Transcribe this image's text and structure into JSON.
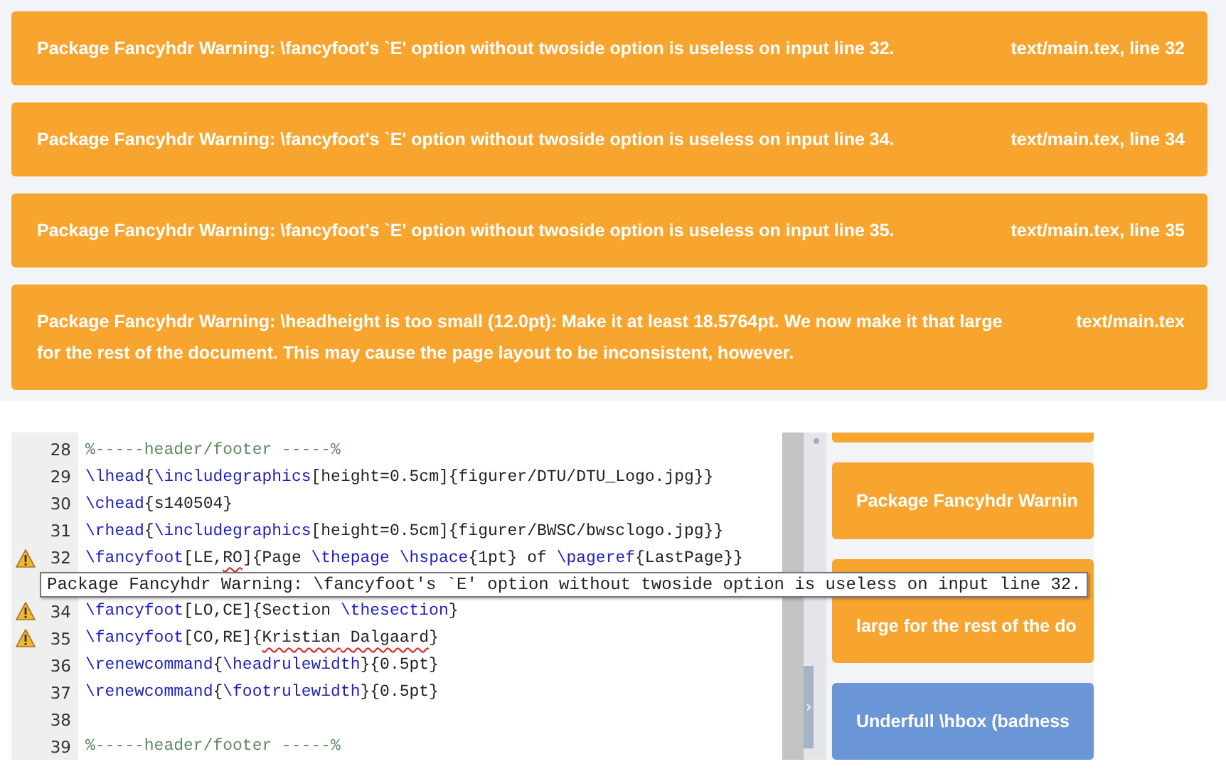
{
  "messages": [
    {
      "color": "#f8a52f",
      "text": "Package Fancyhdr Warning: \\fancyfoot's `E' option without twoside option is useless on input line 32.",
      "location": "text/main.tex, line 32"
    },
    {
      "color": "#f8a52f",
      "text": "Package Fancyhdr Warning: \\fancyfoot's `E' option without twoside option is useless on input line 34.",
      "location": "text/main.tex, line 34"
    },
    {
      "color": "#f8a52f",
      "text": "Package Fancyhdr Warning: \\fancyfoot's `E' option without twoside option is useless on input line 35.",
      "location": "text/main.tex, line 35"
    },
    {
      "color": "#f8a52f",
      "text": "Package Fancyhdr Warning: \\headheight is too small (12.0pt): Make it at least 18.5764pt. We now make it that large for the rest of the document. This may cause the page layout to be inconsistent, however.",
      "location": "text/main.tex"
    }
  ],
  "editor": {
    "lines": [
      {
        "kind": "code",
        "number": "28",
        "warning": false,
        "tokens": [
          {
            "kind": "comment",
            "text": "%-----header/footer -----%"
          }
        ]
      },
      {
        "kind": "code",
        "number": "29",
        "warning": false,
        "tokens": [
          {
            "kind": "command",
            "text": "\\lhead"
          },
          {
            "kind": "text",
            "text": "{"
          },
          {
            "kind": "command",
            "text": "\\includegraphics"
          },
          {
            "kind": "text",
            "text": "[height=0.5cm]{figurer/DTU/DTU_Logo.jpg}}"
          }
        ]
      },
      {
        "kind": "code",
        "number": "30",
        "warning": false,
        "tokens": [
          {
            "kind": "command",
            "text": "\\chead"
          },
          {
            "kind": "text",
            "text": "{s140504}"
          }
        ]
      },
      {
        "kind": "code",
        "number": "31",
        "warning": false,
        "tokens": [
          {
            "kind": "command",
            "text": "\\rhead"
          },
          {
            "kind": "text",
            "text": "{"
          },
          {
            "kind": "command",
            "text": "\\includegraphics"
          },
          {
            "kind": "text",
            "text": "[height=0.5cm]{figurer/BWSC/bwsclogo.jpg}}"
          }
        ]
      },
      {
        "kind": "code",
        "number": "32",
        "warning": true,
        "tokens": [
          {
            "kind": "command",
            "text": "\\fancyfoot"
          },
          {
            "kind": "text",
            "text": "[LE,"
          },
          {
            "kind": "text",
            "text": "RO",
            "squiggle": true
          },
          {
            "kind": "text",
            "text": "]{Page "
          },
          {
            "kind": "command",
            "text": "\\thepage"
          },
          {
            "kind": "command",
            "text": " \\hspace"
          },
          {
            "kind": "text",
            "text": "{1pt} of "
          },
          {
            "kind": "command",
            "text": "\\pageref"
          },
          {
            "kind": "text",
            "text": "{LastPage}}"
          }
        ]
      },
      {
        "kind": "tooltip",
        "text": "Package Fancyhdr Warning: \\fancyfoot's `E' option without twoside option is useless on input line 32."
      },
      {
        "kind": "code",
        "number": "34",
        "warning": true,
        "tokens": [
          {
            "kind": "command",
            "text": "\\fancyfoot"
          },
          {
            "kind": "text",
            "text": "[LO,CE]{Section "
          },
          {
            "kind": "command",
            "text": "\\thesection"
          },
          {
            "kind": "text",
            "text": "}"
          }
        ]
      },
      {
        "kind": "code",
        "number": "35",
        "warning": true,
        "tokens": [
          {
            "kind": "command",
            "text": "\\fancyfoot"
          },
          {
            "kind": "text",
            "text": "[CO,RE]{"
          },
          {
            "kind": "text",
            "text": "Kristian",
            "squiggle": true
          },
          {
            "kind": "text",
            "text": " Dalgaard",
            "squiggle": true
          },
          {
            "kind": "text",
            "text": "}"
          }
        ]
      },
      {
        "kind": "code",
        "number": "36",
        "warning": false,
        "tokens": [
          {
            "kind": "command",
            "text": "\\renewcommand"
          },
          {
            "kind": "text",
            "text": "{"
          },
          {
            "kind": "command",
            "text": "\\headrulewidth"
          },
          {
            "kind": "text",
            "text": "}{0.5pt}"
          }
        ]
      },
      {
        "kind": "code",
        "number": "37",
        "warning": false,
        "tokens": [
          {
            "kind": "command",
            "text": "\\renewcommand"
          },
          {
            "kind": "text",
            "text": "{"
          },
          {
            "kind": "command",
            "text": "\\footrulewidth"
          },
          {
            "kind": "text",
            "text": "}{0.5pt}"
          }
        ]
      },
      {
        "kind": "code",
        "number": "38",
        "warning": false
      },
      {
        "kind": "code",
        "number": "39",
        "warning": false,
        "tokens": [
          {
            "kind": "comment",
            "text": "%-----header/footer -----%"
          }
        ]
      }
    ]
  },
  "side_panel": {
    "toggle": "›",
    "messages": [
      {
        "color": "#f8a52f"
      },
      {
        "color": "#f8a52f",
        "lines": [
          "Package Fancyhdr Warnin"
        ]
      },
      {
        "color": "#f8a52f",
        "lines": [
          "large for the rest of the do"
        ]
      },
      {
        "color": "#6a95d6",
        "lines": [
          "Underfull \\hbox (badness "
        ]
      }
    ]
  }
}
